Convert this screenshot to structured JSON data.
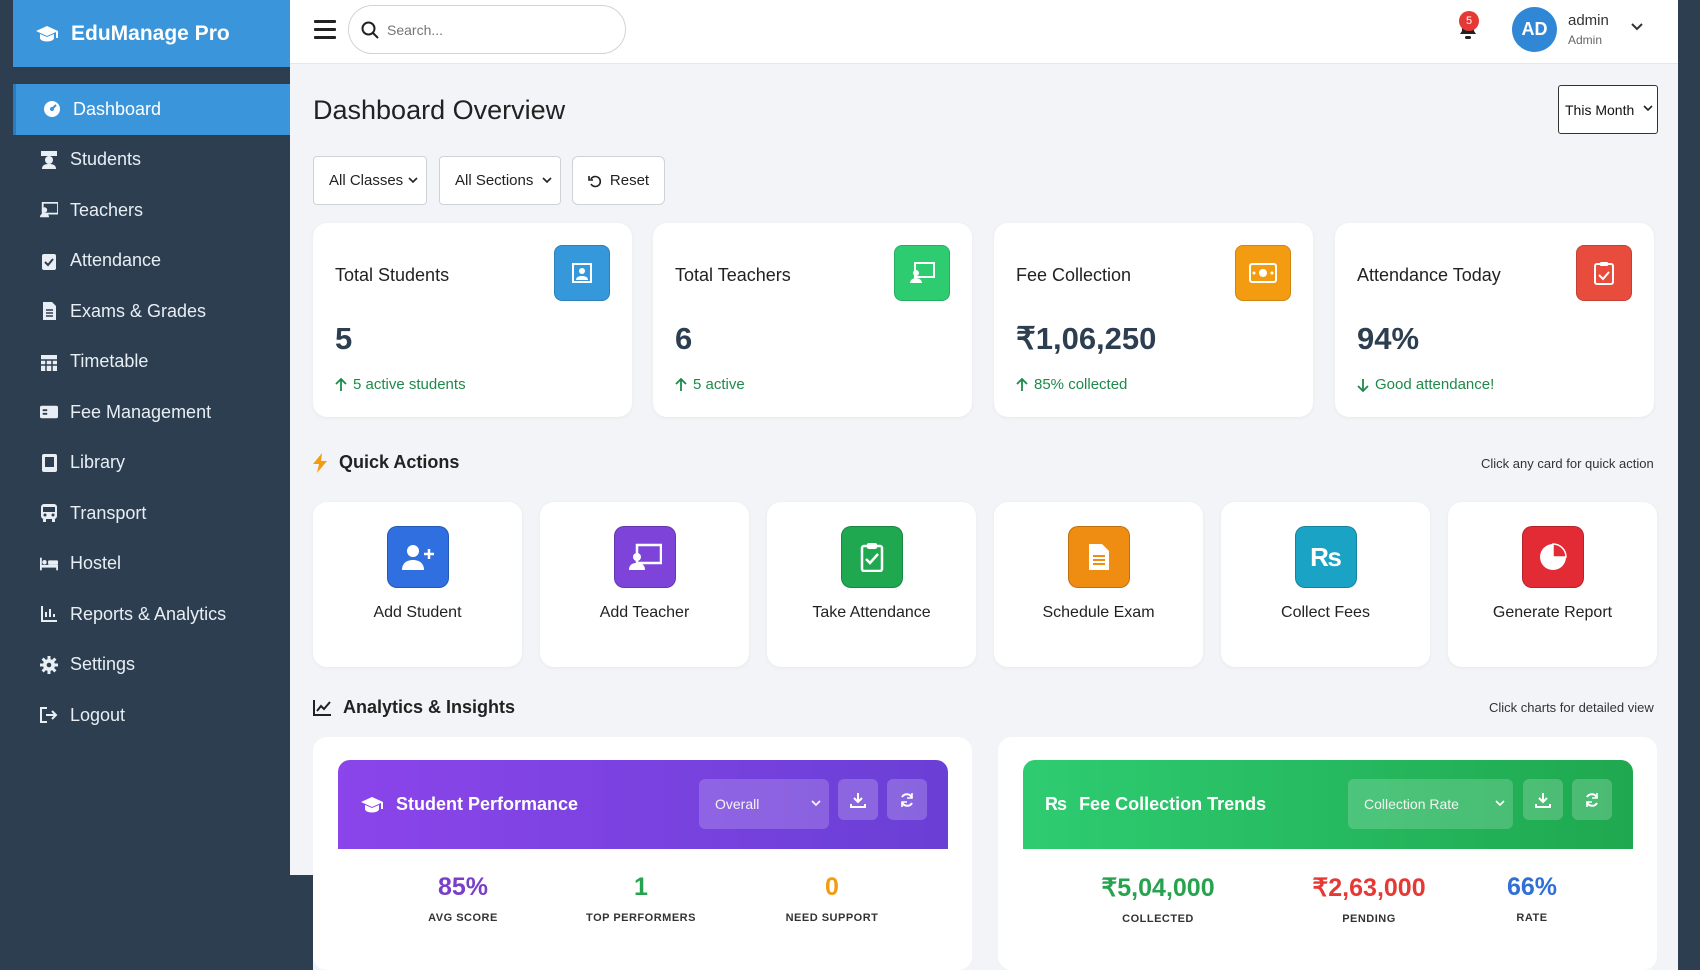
{
  "app": {
    "title": "EduManage Pro"
  },
  "sidebar": {
    "items": [
      {
        "label": "Dashboard",
        "icon": "dashboard-icon",
        "active": true
      },
      {
        "label": "Students",
        "icon": "student-icon"
      },
      {
        "label": "Teachers",
        "icon": "teacher-icon"
      },
      {
        "label": "Attendance",
        "icon": "clipboard-check-icon"
      },
      {
        "label": "Exams & Grades",
        "icon": "file-icon"
      },
      {
        "label": "Timetable",
        "icon": "calendar-icon"
      },
      {
        "label": "Fee Management",
        "icon": "money-icon"
      },
      {
        "label": "Library",
        "icon": "book-icon"
      },
      {
        "label": "Transport",
        "icon": "bus-icon"
      },
      {
        "label": "Hostel",
        "icon": "bed-icon"
      },
      {
        "label": "Reports & Analytics",
        "icon": "chart-icon"
      },
      {
        "label": "Settings",
        "icon": "gear-icon"
      },
      {
        "label": "Logout",
        "icon": "logout-icon"
      }
    ]
  },
  "header": {
    "search_placeholder": "Search...",
    "notifications": "5",
    "avatar_initials": "AD",
    "user_name": "admin",
    "user_role": "Admin"
  },
  "page": {
    "title": "Dashboard Overview",
    "period": "This Month"
  },
  "filters": {
    "classes": "All Classes",
    "sections": "All Sections",
    "reset": "Reset"
  },
  "stats": [
    {
      "label": "Total Students",
      "value": "5",
      "sub": "5 active students",
      "trend": "up",
      "color": "#3498db"
    },
    {
      "label": "Total Teachers",
      "value": "6",
      "sub": "5 active",
      "trend": "up",
      "color": "#2ecc71"
    },
    {
      "label": "Fee Collection",
      "value": "₹1,06,250",
      "sub": "85% collected",
      "trend": "up",
      "color": "#f39c12"
    },
    {
      "label": "Attendance Today",
      "value": "94%",
      "sub": "Good attendance!",
      "trend": "down",
      "color": "#e74c3c"
    }
  ],
  "quick_actions": {
    "title": "Quick Actions",
    "hint": "Click any card for quick action",
    "items": [
      {
        "label": "Add Student",
        "color": "#2f6fe0"
      },
      {
        "label": "Add Teacher",
        "color": "#7e44d9"
      },
      {
        "label": "Take Attendance",
        "color": "#1fa84f"
      },
      {
        "label": "Schedule Exam",
        "color": "#ef8c12"
      },
      {
        "label": "Collect Fees",
        "color": "#1aa3c4"
      },
      {
        "label": "Generate Report",
        "color": "#e22b35"
      }
    ]
  },
  "analytics": {
    "title": "Analytics & Insights",
    "hint": "Click charts for detailed view",
    "performance": {
      "title": "Student Performance",
      "select": "Overall",
      "stats": [
        {
          "value": "85%",
          "label": "AVG SCORE",
          "color": "#7a3fc8"
        },
        {
          "value": "1",
          "label": "TOP PERFORMERS",
          "color": "#27a34f"
        },
        {
          "value": "0",
          "label": "NEED SUPPORT",
          "color": "#f39c12"
        }
      ]
    },
    "fees": {
      "title": "Fee Collection Trends",
      "select": "Collection Rate",
      "stats": [
        {
          "value": "₹5,04,000",
          "label": "COLLECTED",
          "color": "#27a34f"
        },
        {
          "value": "₹2,63,000",
          "label": "PENDING",
          "color": "#e53935"
        },
        {
          "value": "66%",
          "label": "RATE",
          "color": "#2f6fd6"
        }
      ]
    }
  }
}
